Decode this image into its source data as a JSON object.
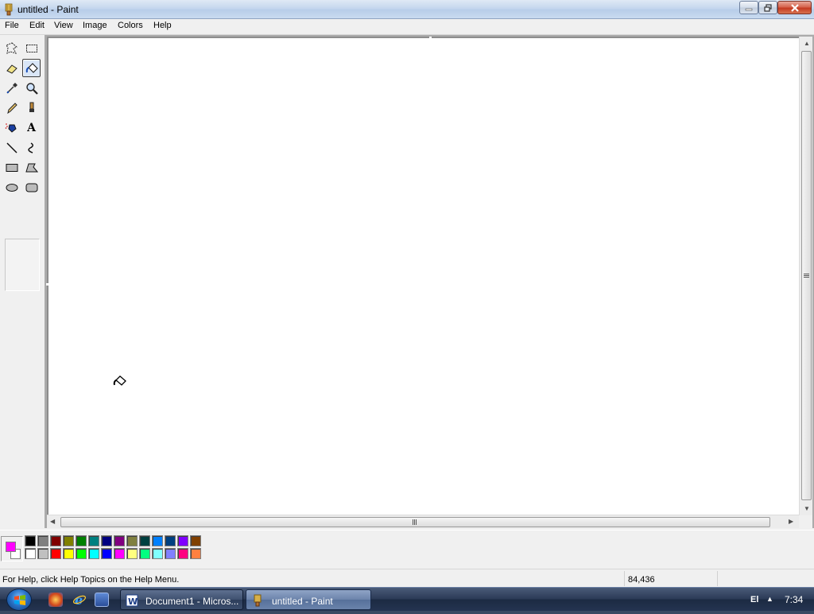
{
  "window": {
    "title": "untitled - Paint"
  },
  "menu": {
    "items": [
      "File",
      "Edit",
      "View",
      "Image",
      "Colors",
      "Help"
    ]
  },
  "tools": [
    {
      "name": "free-form-select-icon"
    },
    {
      "name": "rectangle-select-icon"
    },
    {
      "name": "eraser-icon"
    },
    {
      "name": "fill-with-color-icon",
      "active": true
    },
    {
      "name": "pick-color-icon"
    },
    {
      "name": "magnifier-icon"
    },
    {
      "name": "pencil-icon"
    },
    {
      "name": "brush-icon"
    },
    {
      "name": "airbrush-icon"
    },
    {
      "name": "text-icon",
      "label": "A"
    },
    {
      "name": "line-icon"
    },
    {
      "name": "curve-icon"
    },
    {
      "name": "rectangle-icon"
    },
    {
      "name": "polygon-icon"
    },
    {
      "name": "ellipse-icon"
    },
    {
      "name": "rounded-rectangle-icon"
    }
  ],
  "palette": {
    "foreground": "#ff00ff",
    "background": "#ffffff",
    "row1": [
      "#000000",
      "#808080",
      "#800000",
      "#808000",
      "#008000",
      "#008080",
      "#000080",
      "#800080",
      "#808040",
      "#004040",
      "#0080ff",
      "#004080",
      "#8000ff",
      "#804000"
    ],
    "row2": [
      "#ffffff",
      "#c0c0c0",
      "#ff0000",
      "#ffff00",
      "#00ff00",
      "#00ffff",
      "#0000ff",
      "#ff00ff",
      "#ffff80",
      "#00ff80",
      "#80ffff",
      "#8080ff",
      "#ff0080",
      "#ff8040"
    ]
  },
  "status": {
    "help_text": "For Help, click Help Topics on the Help Menu.",
    "coords": "84,436"
  },
  "taskbar": {
    "buttons": [
      {
        "label": "Document1 - Micros...",
        "icon": "word-icon",
        "active": false
      },
      {
        "label": "untitled - Paint",
        "icon": "paint-icon",
        "active": true
      }
    ],
    "language": "El",
    "clock": "7:34"
  }
}
